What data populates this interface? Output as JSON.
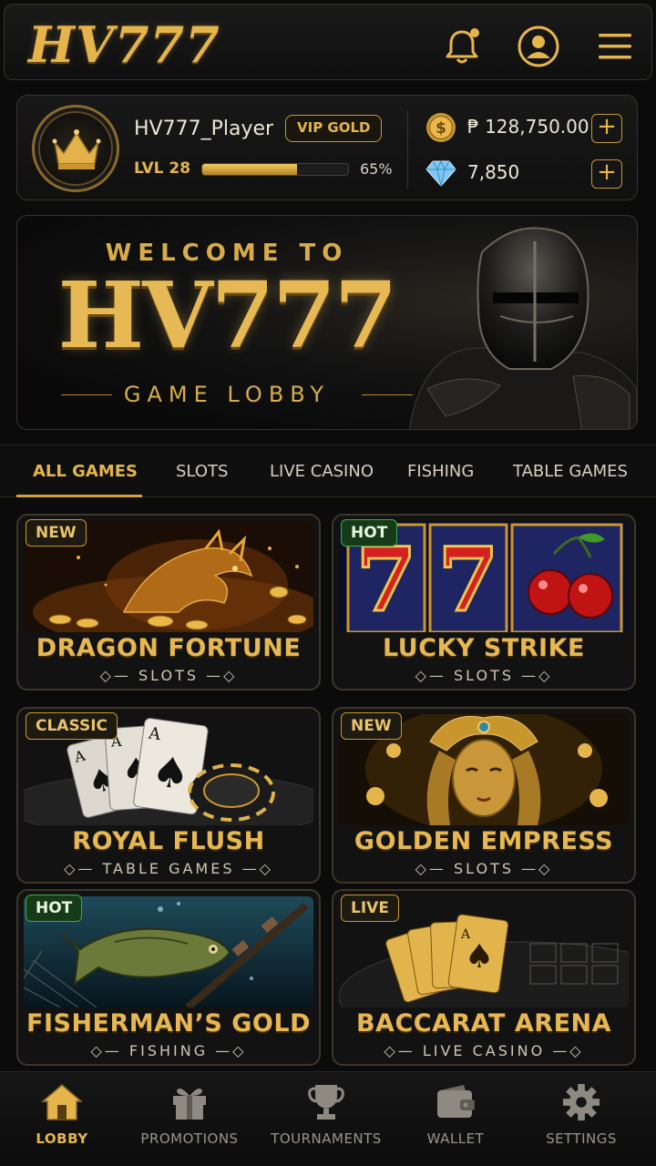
{
  "app": {
    "logo": "HV777"
  },
  "header": {
    "icons": [
      "bell-icon",
      "user-icon",
      "menu-icon"
    ]
  },
  "profile": {
    "username": "HV777_Player",
    "vip_badge": "VIP GOLD",
    "level": "LVL 28",
    "progress_percent": 65,
    "progress_label": "65%",
    "balance": "₱ 128,750.00",
    "gems": "7,850"
  },
  "banner": {
    "welcome": "WELCOME TO",
    "title": "HV777",
    "subtitle": "GAME LOBBY"
  },
  "tabs": [
    {
      "label": "ALL GAMES",
      "active": true
    },
    {
      "label": "SLOTS"
    },
    {
      "label": "LIVE CASINO"
    },
    {
      "label": "FISHING"
    },
    {
      "label": "TABLE GAMES"
    }
  ],
  "games": [
    {
      "title": "DRAGON FORTUNE",
      "category": "SLOTS",
      "badge": "NEW"
    },
    {
      "title": "LUCKY STRIKE",
      "category": "SLOTS",
      "badge": "HOT"
    },
    {
      "title": "ROYAL FLUSH",
      "category": "TABLE GAMES",
      "badge": "CLASSIC"
    },
    {
      "title": "GOLDEN EMPRESS",
      "category": "SLOTS",
      "badge": "NEW"
    },
    {
      "title": "FISHERMAN’S GOLD",
      "category": "FISHING",
      "badge": "HOT"
    },
    {
      "title": "BACCARAT ARENA",
      "category": "LIVE CASINO",
      "badge": "LIVE"
    }
  ],
  "bottom_nav": [
    {
      "label": "LOBBY",
      "icon": "home-icon",
      "active": true
    },
    {
      "label": "PROMOTIONS",
      "icon": "gift-icon"
    },
    {
      "label": "TOURNAMENTS",
      "icon": "trophy-icon"
    },
    {
      "label": "WALLET",
      "icon": "wallet-icon"
    },
    {
      "label": "SETTINGS",
      "icon": "gear-icon"
    }
  ],
  "colors": {
    "accent": "#e5b54c",
    "hot": "#3fa84a",
    "background": "#0b0b0b"
  }
}
